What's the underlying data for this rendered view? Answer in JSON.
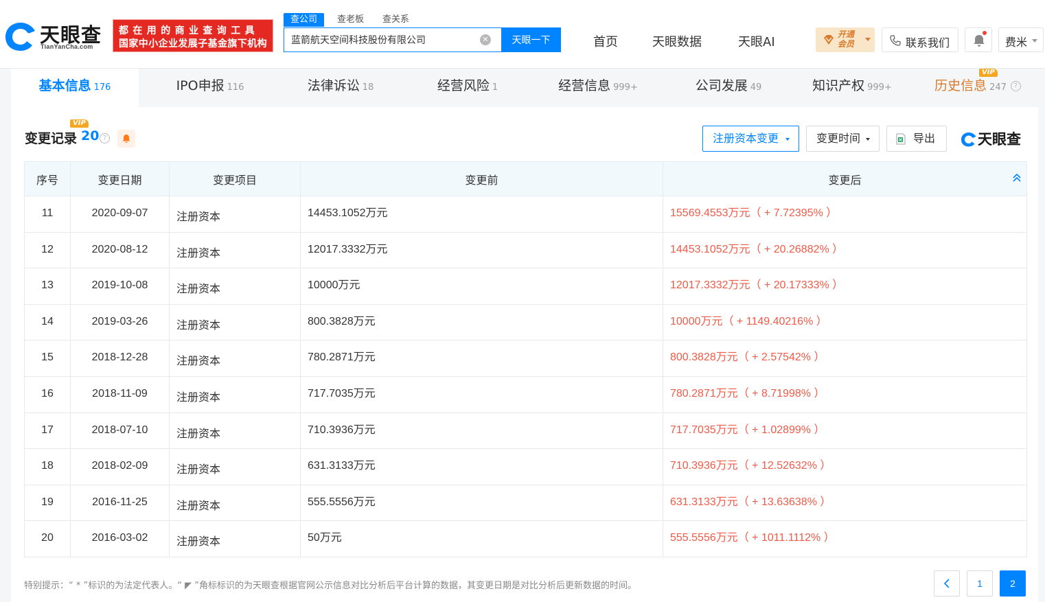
{
  "header": {
    "logo_text": "天眼查",
    "logo_sub": "TianYanCha.com",
    "slogan_line1": "都在用的商业查询工具",
    "slogan_line2": "国家中小企业发展子基金旗下机构",
    "search_tabs": [
      "查公司",
      "查老板",
      "查关系"
    ],
    "search_value": "蓝箭航天空间科技股份有限公司",
    "search_button": "天眼一下",
    "nav": [
      "首页",
      "天眼数据",
      "天眼AI"
    ],
    "vip_label": "开通会员",
    "contact_label": "联系我们",
    "user_label": "费米",
    "brand_color": "#0084ff"
  },
  "section_tabs": [
    {
      "label": "基本信息",
      "count": "176"
    },
    {
      "label": "IPO申报",
      "count": "116"
    },
    {
      "label": "法律诉讼",
      "count": "18"
    },
    {
      "label": "经营风险",
      "count": "1"
    },
    {
      "label": "经营信息",
      "count": "999+"
    },
    {
      "label": "公司发展",
      "count": "49"
    },
    {
      "label": "知识产权",
      "count": "999+"
    },
    {
      "label": "历史信息",
      "count": "247",
      "vip": "VIP"
    }
  ],
  "records": {
    "title": "变更记录",
    "count": "20",
    "vip": "VIP",
    "filter_capital": "注册资本变更",
    "filter_time": "变更时间",
    "export_label": "导出",
    "watermark": "天眼查"
  },
  "table": {
    "headers": [
      "序号",
      "变更日期",
      "变更项目",
      "变更前",
      "变更后"
    ],
    "rows": [
      {
        "no": "11",
        "date": "2020-09-07",
        "item": "注册资本",
        "before": "14453.1052万元",
        "after": "15569.4553万元（ + 7.72395% ）"
      },
      {
        "no": "12",
        "date": "2020-08-12",
        "item": "注册资本",
        "before": "12017.3332万元",
        "after": "14453.1052万元（ + 20.26882% ）"
      },
      {
        "no": "13",
        "date": "2019-10-08",
        "item": "注册资本",
        "before": "10000万元",
        "after": "12017.3332万元（ + 20.17333% ）"
      },
      {
        "no": "14",
        "date": "2019-03-26",
        "item": "注册资本",
        "before": "800.3828万元",
        "after": "10000万元（ + 1149.40216% ）"
      },
      {
        "no": "15",
        "date": "2018-12-28",
        "item": "注册资本",
        "before": "780.2871万元",
        "after": "800.3828万元（ + 2.57542% ）"
      },
      {
        "no": "16",
        "date": "2018-11-09",
        "item": "注册资本",
        "before": "717.7035万元",
        "after": "780.2871万元（ + 8.71998% ）"
      },
      {
        "no": "17",
        "date": "2018-07-10",
        "item": "注册资本",
        "before": "710.3936万元",
        "after": "717.7035万元（ + 1.02899% ）"
      },
      {
        "no": "18",
        "date": "2018-02-09",
        "item": "注册资本",
        "before": "631.3133万元",
        "after": "710.3936万元（ + 12.52632% ）"
      },
      {
        "no": "19",
        "date": "2016-11-25",
        "item": "注册资本",
        "before": "555.5556万元",
        "after": "631.3133万元（ + 13.63638% ）"
      },
      {
        "no": "20",
        "date": "2016-03-02",
        "item": "注册资本",
        "before": "50万元",
        "after": "555.5556万元（ + 1011.1112% ）"
      }
    ]
  },
  "note": "特别提示：“ * ”标识的为法定代表人。“ ◤ ”角标标识的为天眼查根据官网公示信息对比分析后平台计算的数据，其变更日期是对比分析后更新数据的时间。",
  "pagination": {
    "prev": "‹",
    "pages": [
      "1",
      "2"
    ],
    "current": "2"
  }
}
